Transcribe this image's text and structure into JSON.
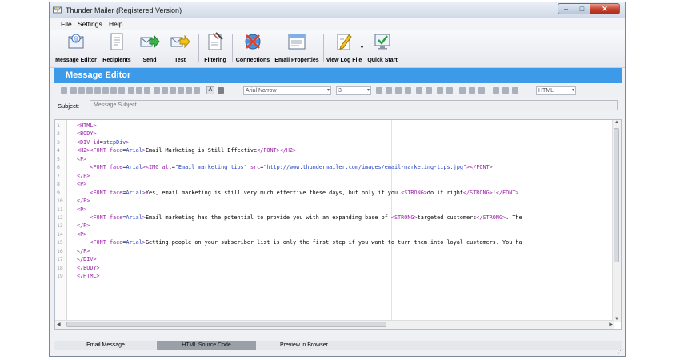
{
  "window": {
    "title": "Thunder Mailer (Registered Version)"
  },
  "menu": [
    "File",
    "Settings",
    "Help"
  ],
  "toolbar": [
    {
      "label": "Message Editor",
      "icon": "message-editor-icon"
    },
    {
      "label": "Recipients",
      "icon": "recipients-icon"
    },
    {
      "label": "Send",
      "icon": "send-icon"
    },
    {
      "label": "Test",
      "icon": "test-icon"
    },
    {
      "label": "Filtering",
      "icon": "filtering-icon"
    },
    {
      "label": "Connections",
      "icon": "connections-icon"
    },
    {
      "label": "Email Properties",
      "icon": "email-properties-icon"
    },
    {
      "label": "View Log File",
      "icon": "view-log-icon"
    },
    {
      "label": "Quick Start",
      "icon": "quick-start-icon"
    }
  ],
  "banner": {
    "title": "Message Editor"
  },
  "format": {
    "font": "Arial Narrow",
    "size": "3",
    "mode": "HTML",
    "color_swatch": "A"
  },
  "subject": {
    "label": "Subject:",
    "placeholder": "Message Subject"
  },
  "code": {
    "line_numbers": [
      "1",
      "2",
      "3",
      "4",
      "5",
      "6",
      "7",
      "8",
      "9",
      "10",
      "11",
      "12",
      "13",
      "14",
      "15",
      "16",
      "17",
      "18",
      "19"
    ],
    "lines": [
      [
        [
          "k",
          "<HTML>"
        ]
      ],
      [
        [
          "k",
          "<BODY>"
        ]
      ],
      [
        [
          "k",
          "<DIV "
        ],
        [
          "k",
          "id"
        ],
        [
          "t",
          "="
        ],
        [
          "a",
          "stcpDiv"
        ],
        [
          "k",
          ">"
        ]
      ],
      [
        [
          "k",
          "<H2><FONT "
        ],
        [
          "k",
          "face"
        ],
        [
          "t",
          "="
        ],
        [
          "a",
          "Arial"
        ],
        [
          "k",
          ">"
        ],
        [
          "t",
          "Email Marketing is Still Effective"
        ],
        [
          "k",
          "</FONT></H2>"
        ]
      ],
      [
        [
          "k",
          "<P>"
        ]
      ],
      [
        [
          "t",
          "    "
        ],
        [
          "k",
          "<FONT "
        ],
        [
          "k",
          "face"
        ],
        [
          "t",
          "="
        ],
        [
          "a",
          "Arial"
        ],
        [
          "k",
          "><IMG "
        ],
        [
          "k",
          "alt"
        ],
        [
          "t",
          "="
        ],
        [
          "a",
          "\"Email marketing tips\""
        ],
        [
          "t",
          " "
        ],
        [
          "k",
          "src"
        ],
        [
          "t",
          "="
        ],
        [
          "a",
          "\"http://www.thundermailer.com/images/email-marketing-tips.jpg\""
        ],
        [
          "k",
          "></FONT>"
        ]
      ],
      [
        [
          "k",
          "</P>"
        ]
      ],
      [
        [
          "k",
          "<P>"
        ]
      ],
      [
        [
          "t",
          "    "
        ],
        [
          "k",
          "<FONT "
        ],
        [
          "k",
          "face"
        ],
        [
          "t",
          "="
        ],
        [
          "a",
          "Arial"
        ],
        [
          "k",
          ">"
        ],
        [
          "t",
          "Yes, email marketing is still very much effective these days, but only if you "
        ],
        [
          "k",
          "<STRONG>"
        ],
        [
          "t",
          "do it right"
        ],
        [
          "k",
          "</STRONG>"
        ],
        [
          "t",
          "!"
        ],
        [
          "k",
          "</FONT>"
        ]
      ],
      [
        [
          "k",
          "</P>"
        ]
      ],
      [
        [
          "k",
          "<P>"
        ]
      ],
      [
        [
          "t",
          "    "
        ],
        [
          "k",
          "<FONT "
        ],
        [
          "k",
          "face"
        ],
        [
          "t",
          "="
        ],
        [
          "a",
          "Arial"
        ],
        [
          "k",
          ">"
        ],
        [
          "t",
          "Email marketing has the potential to provide you with an expanding base of "
        ],
        [
          "k",
          "<STRONG>"
        ],
        [
          "t",
          "targeted customers"
        ],
        [
          "k",
          "</STRONG>"
        ],
        [
          "t",
          ". The"
        ]
      ],
      [
        [
          "k",
          "</P>"
        ]
      ],
      [
        [
          "k",
          "<P>"
        ]
      ],
      [
        [
          "t",
          "    "
        ],
        [
          "k",
          "<FONT "
        ],
        [
          "k",
          "face"
        ],
        [
          "t",
          "="
        ],
        [
          "a",
          "Arial"
        ],
        [
          "k",
          ">"
        ],
        [
          "t",
          "Getting people on your subscriber list is only the first step if you want to turn them into loyal customers. You ha"
        ]
      ],
      [
        [
          "k",
          "</P>"
        ]
      ],
      [
        [
          "k",
          "</DIV>"
        ]
      ],
      [
        [
          "k",
          "</BODY>"
        ]
      ],
      [
        [
          "k",
          "</HTML>"
        ]
      ]
    ]
  },
  "tabs": [
    "Email Message",
    "HTML Source Code",
    "Preview in Browser"
  ],
  "colors": {
    "banner": "#3c9ae8",
    "tag": "#9b1fa8",
    "string": "#1f3fbf",
    "active_tab": "#9aa0a8"
  }
}
